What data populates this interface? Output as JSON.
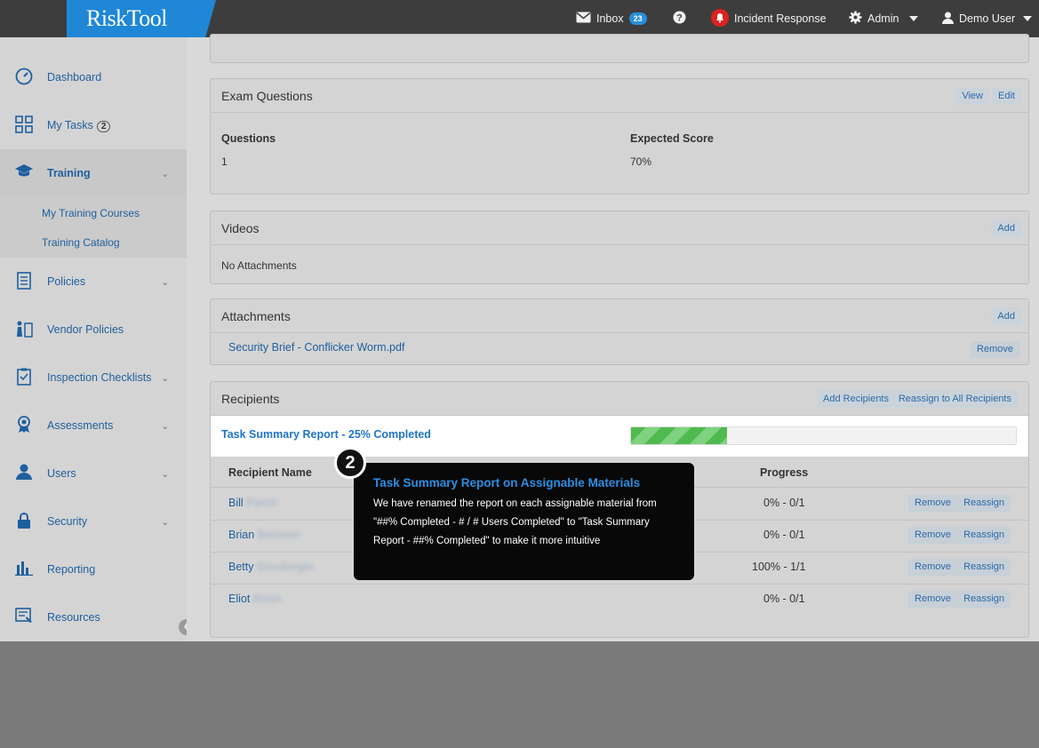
{
  "app": {
    "logo": "RiskTool"
  },
  "topnav": {
    "inbox_label": "Inbox",
    "inbox_count": "23",
    "incident_label": "Incident Response",
    "admin_label": "Admin",
    "user_label": "Demo User"
  },
  "sidebar": {
    "items": [
      {
        "label": "Dashboard",
        "icon": "gauge-icon"
      },
      {
        "label": "My Tasks",
        "icon": "tasks-icon",
        "badge": "2"
      },
      {
        "label": "Training",
        "icon": "graduation-cap-icon"
      },
      {
        "label": "Policies",
        "icon": "document-icon"
      },
      {
        "label": "Vendor Policies",
        "icon": "vendor-icon"
      },
      {
        "label": "Inspection Checklists",
        "icon": "checklist-icon"
      },
      {
        "label": "Assessments",
        "icon": "ribbon-icon"
      },
      {
        "label": "Users",
        "icon": "user-icon"
      },
      {
        "label": "Security",
        "icon": "lock-icon"
      },
      {
        "label": "Reporting",
        "icon": "bar-chart-icon"
      },
      {
        "label": "Resources",
        "icon": "resources-icon"
      }
    ],
    "training_sub": [
      {
        "label": "My Training Courses"
      },
      {
        "label": "Training Catalog"
      }
    ]
  },
  "exam": {
    "title": "Exam Questions",
    "view_label": "View",
    "edit_label": "Edit",
    "questions_header": "Questions",
    "questions_value": "1",
    "score_header": "Expected Score",
    "score_value": "70%"
  },
  "videos": {
    "title": "Videos",
    "add_label": "Add",
    "empty_text": "No Attachments"
  },
  "attachments": {
    "title": "Attachments",
    "add_label": "Add",
    "file_name": "Security Brief - Conflicker Worm.pdf",
    "remove_label": "Remove"
  },
  "recipients": {
    "title": "Recipients",
    "add_label": "Add Recipients",
    "reassign_all_label": "Reassign to All Recipients",
    "summary_link": "Task Summary Report - 25% Completed",
    "summary_progress": 0.25,
    "col_name": "Recipient Name",
    "col_progress": "Progress",
    "remove_label": "Remove",
    "reassign_label": "Reassign",
    "rows": [
      {
        "first": "Bill",
        "last": "Parish",
        "progress": "0% - 0/1"
      },
      {
        "first": "Brian",
        "last": "Bremner",
        "progress": "0% - 0/1"
      },
      {
        "first": "Betty",
        "last": "Greuberger",
        "progress": "100% - 1/1"
      },
      {
        "first": "Eliot",
        "last": "Bison",
        "progress": "0% - 0/1"
      }
    ]
  },
  "tooltip": {
    "step": "2",
    "title": "Task Summary Report on Assignable Materials",
    "body": "We have renamed the report on each assignable material from \"##% Completed - # / # Users Completed\" to \"Task Summary Report - ##% Completed\" to make it more intuitive"
  },
  "colors": {
    "brand": "#1f87d6",
    "accent_link": "#1f5f9e",
    "progress_green": "#4fba4f",
    "tooltip_bg": "#080808"
  }
}
